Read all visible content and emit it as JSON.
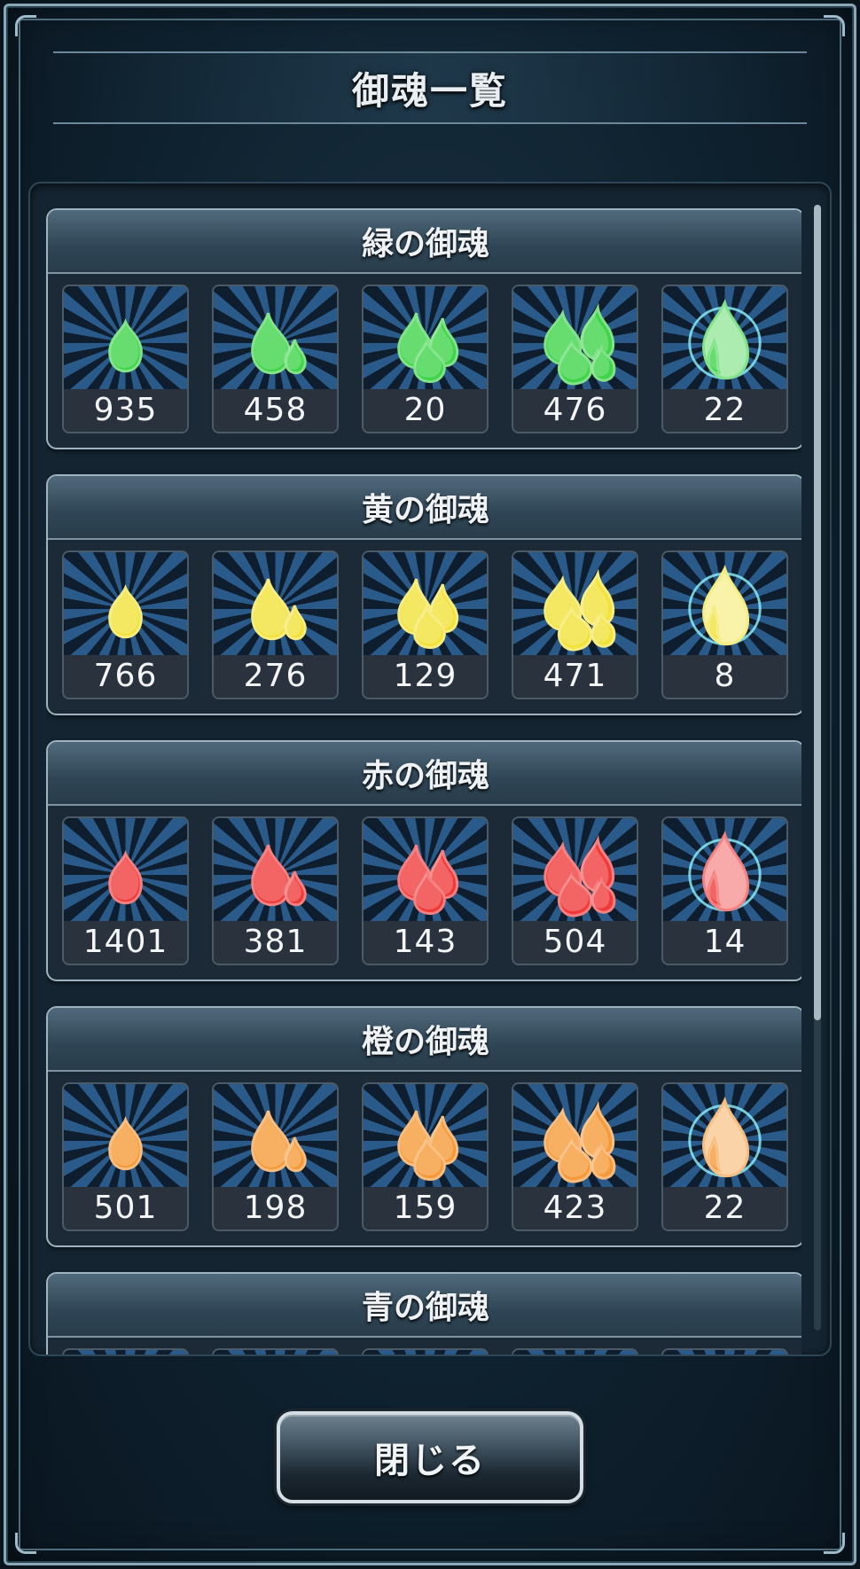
{
  "dialog": {
    "title": "御魂一覧",
    "close_label": "閉じる"
  },
  "sections": [
    {
      "title": "緑の御魂",
      "color": "#3fd44a",
      "counts": [
        "935",
        "458",
        "20",
        "476",
        "22"
      ]
    },
    {
      "title": "黄の御魂",
      "color": "#f2e23a",
      "counts": [
        "766",
        "276",
        "129",
        "471",
        "8"
      ]
    },
    {
      "title": "赤の御魂",
      "color": "#f03b3b",
      "counts": [
        "1401",
        "381",
        "143",
        "504",
        "14"
      ]
    },
    {
      "title": "橙の御魂",
      "color": "#f59a3a",
      "counts": [
        "501",
        "198",
        "159",
        "423",
        "22"
      ]
    },
    {
      "title": "青の御魂",
      "color": "#3a8af5",
      "counts": [
        "",
        "",
        "",
        "",
        ""
      ]
    }
  ],
  "item_icons": [
    "single-flame-icon",
    "double-flame-icon",
    "triple-flame-icon",
    "flame-cluster-icon",
    "radiant-flame-icon"
  ]
}
